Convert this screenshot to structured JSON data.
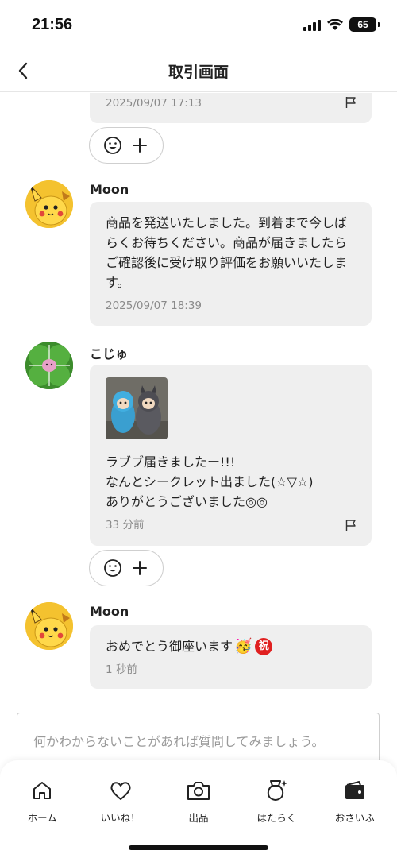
{
  "status_bar": {
    "time": "21:56",
    "battery": "65"
  },
  "header": {
    "title": "取引画面"
  },
  "messages": [
    {
      "timestamp": "2025/09/07 17:13"
    },
    {
      "user": "Moon",
      "text": "商品を発送いたしました。到着まで今しばらくお待ちください。商品が届きましたらご確認後に受け取り評価をお願いいたします。",
      "timestamp": "2025/09/07 18:39"
    },
    {
      "user": "こじゅ",
      "lines": [
        "ラブブ届きましたー!!!",
        "なんとシークレット出ました(☆▽☆)",
        "ありがとうございました◎◎"
      ],
      "timestamp": "33 分前"
    },
    {
      "user": "Moon",
      "text": "おめでとう御座います",
      "emoji": "🥳",
      "badge": "祝",
      "timestamp": "1 秒前"
    }
  ],
  "input": {
    "placeholder": "何かわからないことがあれば質問してみましょう。"
  },
  "nav": [
    {
      "label": "ホーム",
      "icon": "home-icon"
    },
    {
      "label": "いいね！",
      "icon": "heart-icon"
    },
    {
      "label": "出品",
      "icon": "camera-icon"
    },
    {
      "label": "はたらく",
      "icon": "money-bag-icon"
    },
    {
      "label": "おさいふ",
      "icon": "wallet-icon"
    }
  ],
  "colors": {
    "bubble": "#efefef",
    "badge": "#e02020",
    "timestamp": "#8a8a8a"
  }
}
